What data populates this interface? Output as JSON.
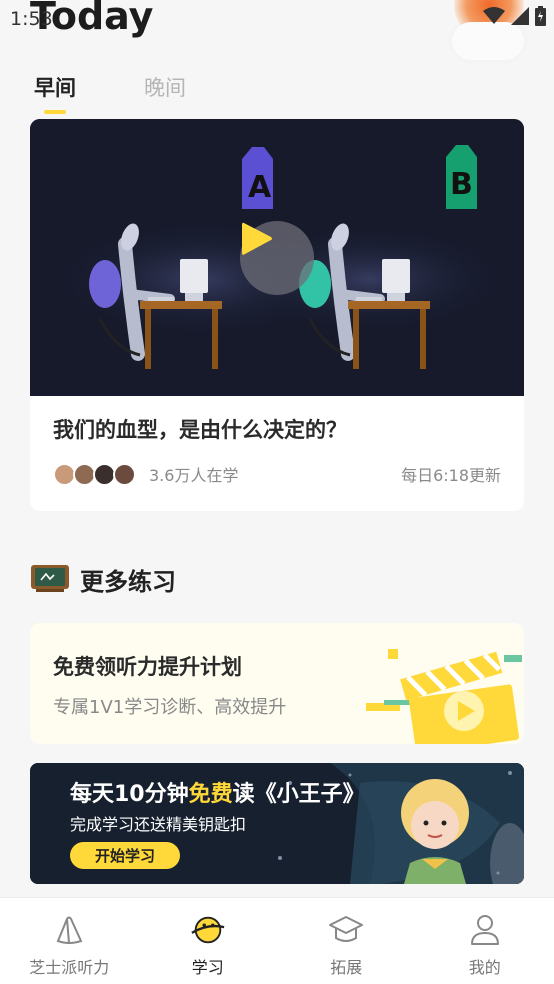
{
  "status_bar": {
    "time": "1:53"
  },
  "header": {
    "title": "Today"
  },
  "tabs": [
    {
      "label": "早间",
      "active": true
    },
    {
      "label": "晚间",
      "active": false
    }
  ],
  "video_card": {
    "title": "我们的血型，是由什么决定的？",
    "learners": "3.6万人在学",
    "update_time": "每日6:18更新",
    "badge_a": "A",
    "badge_b": "B"
  },
  "section": {
    "title": "更多练习"
  },
  "listening_card": {
    "title": "免费领听力提升计划",
    "subtitle": "专属1V1学习诊断、高效提升"
  },
  "banner": {
    "title_prefix": "每天10分钟",
    "title_highlight": "免费",
    "title_suffix": "读《小王子》",
    "subtitle": "完成学习还送精美钥匙扣",
    "button": "开始学习"
  },
  "bottom_nav": [
    {
      "label": "芝士派听力",
      "icon": "cheese-icon",
      "active": false
    },
    {
      "label": "学习",
      "icon": "planet-icon",
      "active": true
    },
    {
      "label": "拓展",
      "icon": "graduation-cap-icon",
      "active": false
    },
    {
      "label": "我的",
      "icon": "person-icon",
      "active": false
    }
  ],
  "colors": {
    "accent": "#ffd83a",
    "background": "#f6f6f6",
    "video_bg": "#161a2b"
  }
}
